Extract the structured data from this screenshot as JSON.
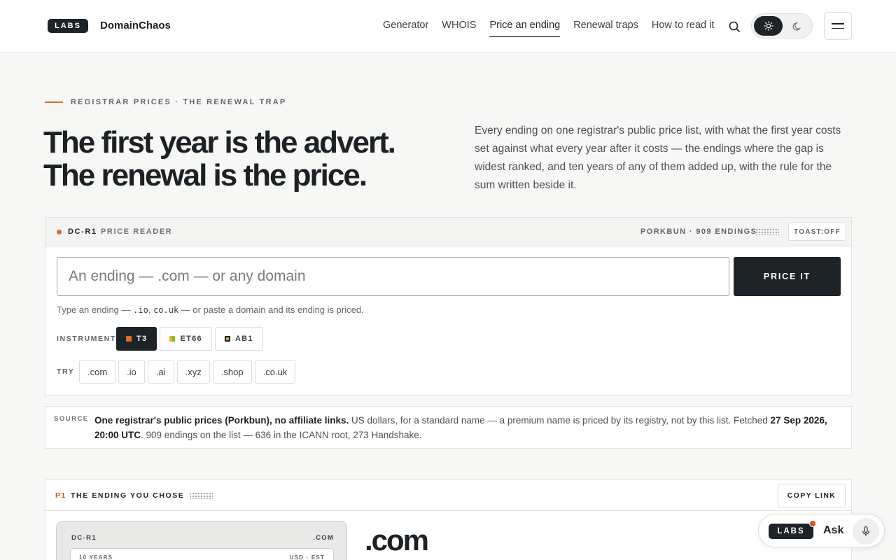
{
  "header": {
    "logo_text": "LABS",
    "brand": "DomainChaos",
    "nav": [
      {
        "label": "Generator"
      },
      {
        "label": "WHOIS"
      },
      {
        "label": "Price an ending",
        "active": true
      },
      {
        "label": "Renewal traps"
      },
      {
        "label": "How to read it"
      }
    ],
    "theme": "light"
  },
  "hero": {
    "eyebrow": "REGISTRAR PRICES · THE RENEWAL TRAP",
    "title_line1": "The first year is the advert.",
    "title_line2": "The renewal is the price.",
    "description": "Every ending on one registrar's public price list, with what the first year costs set against what every year after it costs — the endings where the gap is widest ranked, and ten years of any of them added up, with the rule for the sum written beside it."
  },
  "reader": {
    "id": "DC-R1",
    "name": "PRICE READER",
    "meta": "PORKBUN · 909 ENDINGS",
    "toast": "TOAST:OFF",
    "input_placeholder": "An ending — .com — or any domain",
    "input_value": "",
    "price_button": "PRICE IT",
    "hint_prefix": "Type an ending — ",
    "hint_code1": ".io",
    "hint_sep": ", ",
    "hint_code2": "co.uk",
    "hint_suffix": " — or paste a domain and its ending is priced.",
    "instrument_label": "INSTRUMENT",
    "instruments": [
      {
        "label": "T3",
        "color": "#e06a2a",
        "active": true
      },
      {
        "label": "ET66",
        "color": "#8bb33a",
        "active": false
      },
      {
        "label": "AB1",
        "color": "#e0b21c",
        "active": false
      }
    ],
    "try_label": "TRY",
    "try_chips": [
      ".com",
      ".io",
      ".ai",
      ".xyz",
      ".shop",
      ".co.uk"
    ]
  },
  "source": {
    "label": "SOURCE",
    "bold1": "One registrar's public prices (Porkbun), no affiliate links.",
    "text1": " US dollars, for a standard name — a premium name is priced by its registry, not by this list. Fetched ",
    "bold2": "27 Sep 2026, 20:00 UTC",
    "text2": ". 909 endings on the list — 636 in the ICANN root, 273 Handshake."
  },
  "p1": {
    "num": "P1",
    "title": "THE ENDING YOU CHOSE",
    "copy_button": "COPY LINK",
    "card_id": "DC-R1",
    "card_tld": ".COM",
    "card_years": "10 YEARS",
    "card_unit": "USD · EST",
    "big_tld": ".com"
  },
  "ask": {
    "logo_text": "LABS",
    "label": "Ask"
  },
  "icons": {
    "search": "search-icon",
    "sun": "sun-icon",
    "moon": "moon-icon",
    "menu": "hamburger-icon",
    "mic": "microphone-icon"
  }
}
